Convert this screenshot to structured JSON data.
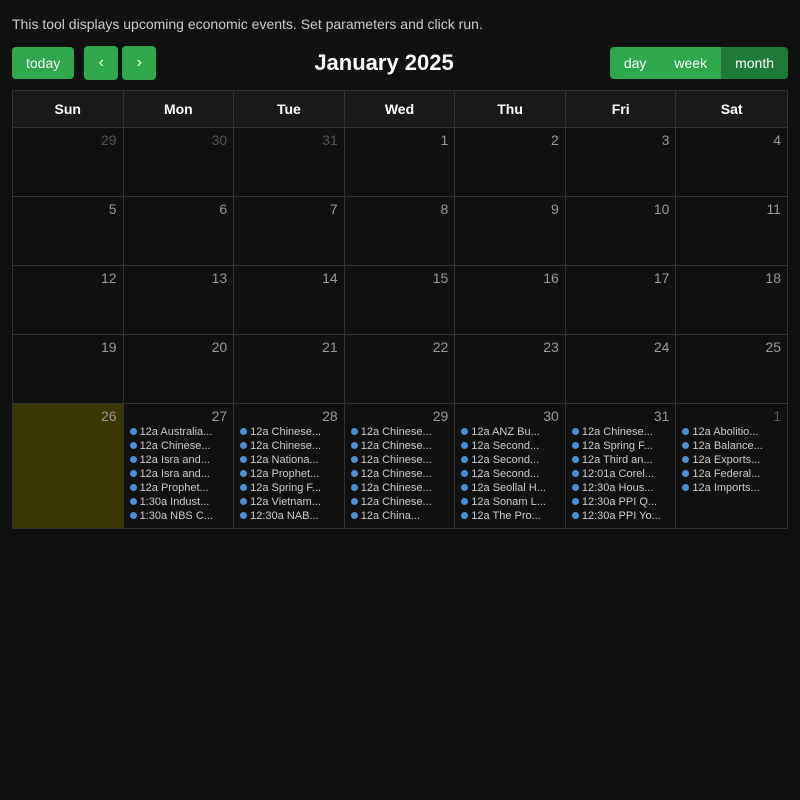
{
  "topbar": {
    "description": "This tool displays upcoming economic events. Set parameters and click run."
  },
  "controls": {
    "today_label": "today",
    "prev_label": "‹",
    "next_label": "›",
    "month_title": "January 2025",
    "view_buttons": [
      "day",
      "week",
      "month"
    ],
    "active_view": "month"
  },
  "calendar": {
    "headers": [
      "Sun",
      "Mon",
      "Tue",
      "Wed",
      "Thu",
      "Fri",
      "Sat"
    ],
    "weeks": [
      {
        "days": [
          {
            "num": "29",
            "other": true,
            "events": []
          },
          {
            "num": "30",
            "other": true,
            "events": []
          },
          {
            "num": "31",
            "other": true,
            "events": []
          },
          {
            "num": "1",
            "other": false,
            "events": []
          },
          {
            "num": "2",
            "other": false,
            "events": []
          },
          {
            "num": "3",
            "other": false,
            "events": []
          },
          {
            "num": "4",
            "other": false,
            "events": []
          }
        ]
      },
      {
        "days": [
          {
            "num": "5",
            "other": false,
            "events": []
          },
          {
            "num": "6",
            "other": false,
            "events": []
          },
          {
            "num": "7",
            "other": false,
            "events": []
          },
          {
            "num": "8",
            "other": false,
            "events": []
          },
          {
            "num": "9",
            "other": false,
            "events": []
          },
          {
            "num": "10",
            "other": false,
            "events": []
          },
          {
            "num": "11",
            "other": false,
            "events": []
          }
        ]
      },
      {
        "days": [
          {
            "num": "12",
            "other": false,
            "events": []
          },
          {
            "num": "13",
            "other": false,
            "events": []
          },
          {
            "num": "14",
            "other": false,
            "events": []
          },
          {
            "num": "15",
            "other": false,
            "events": []
          },
          {
            "num": "16",
            "other": false,
            "events": []
          },
          {
            "num": "17",
            "other": false,
            "events": []
          },
          {
            "num": "18",
            "other": false,
            "events": []
          }
        ]
      },
      {
        "days": [
          {
            "num": "19",
            "other": false,
            "events": []
          },
          {
            "num": "20",
            "other": false,
            "events": []
          },
          {
            "num": "21",
            "other": false,
            "events": []
          },
          {
            "num": "22",
            "other": false,
            "events": []
          },
          {
            "num": "23",
            "other": false,
            "events": []
          },
          {
            "num": "24",
            "other": false,
            "events": []
          },
          {
            "num": "25",
            "other": false,
            "events": []
          }
        ]
      },
      {
        "days": [
          {
            "num": "26",
            "other": false,
            "highlight": "olive",
            "events": []
          },
          {
            "num": "27",
            "other": false,
            "events": [
              {
                "time": "12a",
                "title": "Australia..."
              },
              {
                "time": "12a",
                "title": "Chinese..."
              },
              {
                "time": "12a",
                "title": "Isra and..."
              },
              {
                "time": "12a",
                "title": "Isra and..."
              },
              {
                "time": "12a",
                "title": "Prophet..."
              },
              {
                "time": "1:30a",
                "title": "Indust..."
              },
              {
                "time": "1:30a",
                "title": "NBS C..."
              }
            ]
          },
          {
            "num": "28",
            "other": false,
            "events": [
              {
                "time": "12a",
                "title": "Chinese..."
              },
              {
                "time": "12a",
                "title": "Chinese..."
              },
              {
                "time": "12a",
                "title": "Nationa..."
              },
              {
                "time": "12a",
                "title": "Prophet..."
              },
              {
                "time": "12a",
                "title": "Spring F..."
              },
              {
                "time": "12a",
                "title": "Vietnam..."
              },
              {
                "time": "12:30a",
                "title": "NAB..."
              }
            ]
          },
          {
            "num": "29",
            "other": false,
            "events": [
              {
                "time": "12a",
                "title": "Chinese..."
              },
              {
                "time": "12a",
                "title": "Chinese..."
              },
              {
                "time": "12a",
                "title": "Chinese..."
              },
              {
                "time": "12a",
                "title": "Chinese..."
              },
              {
                "time": "12a",
                "title": "Chinese..."
              },
              {
                "time": "12a",
                "title": "Chinese..."
              },
              {
                "time": "12a",
                "title": "China..."
              }
            ]
          },
          {
            "num": "30",
            "other": false,
            "events": [
              {
                "time": "12a",
                "title": "ANZ Bu..."
              },
              {
                "time": "12a",
                "title": "Second..."
              },
              {
                "time": "12a",
                "title": "Second..."
              },
              {
                "time": "12a",
                "title": "Second..."
              },
              {
                "time": "12a",
                "title": "Seollal H..."
              },
              {
                "time": "12a",
                "title": "Sonam L..."
              },
              {
                "time": "12a",
                "title": "The Pro..."
              }
            ]
          },
          {
            "num": "31",
            "other": false,
            "events": [
              {
                "time": "12a",
                "title": "Chinese..."
              },
              {
                "time": "12a",
                "title": "Spring F..."
              },
              {
                "time": "12a",
                "title": "Third an..."
              },
              {
                "time": "12:01a",
                "title": "Corel..."
              },
              {
                "time": "12:30a",
                "title": "Hous..."
              },
              {
                "time": "12:30a",
                "title": "PPI Q..."
              },
              {
                "time": "12:30a",
                "title": "PPI Yo..."
              }
            ]
          },
          {
            "num": "1",
            "other": true,
            "events": [
              {
                "time": "12a",
                "title": "Abolitio..."
              },
              {
                "time": "12a",
                "title": "Balance..."
              },
              {
                "time": "12a",
                "title": "Exports..."
              },
              {
                "time": "12a",
                "title": "Federal..."
              },
              {
                "time": "12a",
                "title": "Imports..."
              }
            ]
          }
        ]
      }
    ]
  }
}
